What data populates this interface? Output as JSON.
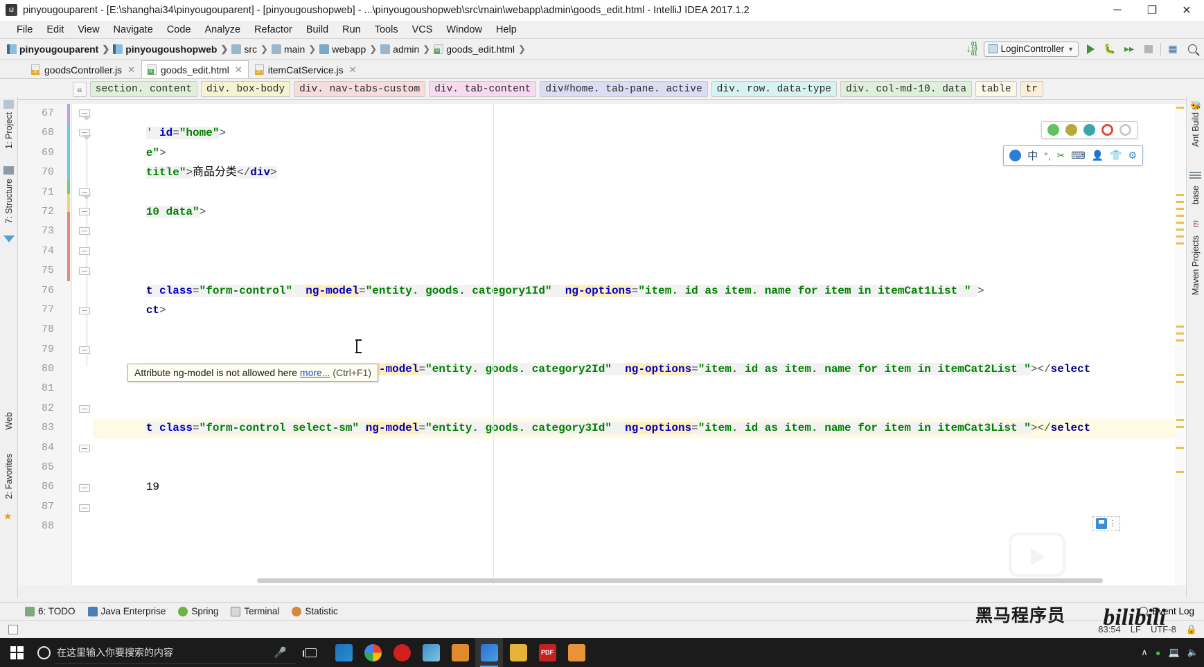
{
  "window": {
    "title": "pinyougouparent - [E:\\shanghai34\\pinyougouparent] - [pinyougoushopweb] - ...\\pinyougoushopweb\\src\\main\\webapp\\admin\\goods_edit.html - IntelliJ IDEA 2017.1.2",
    "minimize": "─",
    "maximize": "❐",
    "close": "✕"
  },
  "menu": [
    "File",
    "Edit",
    "View",
    "Navigate",
    "Code",
    "Analyze",
    "Refactor",
    "Build",
    "Run",
    "Tools",
    "VCS",
    "Window",
    "Help"
  ],
  "navbar": {
    "crumbs": [
      {
        "label": "pinyougouparent",
        "icon": "module-icon",
        "bold": true
      },
      {
        "label": "pinyougoushopweb",
        "icon": "module-icon",
        "bold": true
      },
      {
        "label": "src",
        "icon": "folder-icon",
        "bold": false
      },
      {
        "label": "main",
        "icon": "folder-icon",
        "bold": false
      },
      {
        "label": "webapp",
        "icon": "folder-blue-icon",
        "bold": false
      },
      {
        "label": "admin",
        "icon": "folder-icon",
        "bold": false
      },
      {
        "label": "goods_edit.html",
        "icon": "html-file-icon",
        "bold": false
      }
    ],
    "run_config": "LoginController",
    "icons": [
      "update-project-icon",
      "run-icon",
      "debug-icon",
      "run-coverage-icon",
      "stop-icon",
      "build-icon",
      "search-everywhere-icon"
    ]
  },
  "tabs": [
    {
      "label": "goodsController.js",
      "type": "js",
      "active": false
    },
    {
      "label": "goods_edit.html",
      "type": "html",
      "active": true
    },
    {
      "label": "itemCatService.js",
      "type": "js",
      "active": false
    }
  ],
  "element_breadcrumb": {
    "collapse_label": "«",
    "chips": [
      {
        "label": "section. content",
        "color": "#dff0da"
      },
      {
        "label": "div. box-body",
        "color": "#f5f3d0"
      },
      {
        "label": "div. nav-tabs-custom",
        "color": "#f7dcdc"
      },
      {
        "label": "div. tab-content",
        "color": "#f7daf0"
      },
      {
        "label": "div#home. tab-pane. active",
        "color": "#dcdcf5"
      },
      {
        "label": "div. row. data-type",
        "color": "#d6f2f2"
      },
      {
        "label": "div. col-md-10. data",
        "color": "#dff0da"
      },
      {
        "label": "table",
        "color": "#faf8e8"
      },
      {
        "label": "tr",
        "color": "#faf0da"
      }
    ]
  },
  "left_tool_strip": [
    "1: Project",
    "7: Structure",
    "Web",
    "2: Favorites"
  ],
  "right_tool_strip": [
    "Ant Build",
    "base",
    "m",
    "Maven Projects"
  ],
  "editor": {
    "lines": [
      {
        "num": "67",
        "text": "' id=\"home\">",
        "highlight": false
      },
      {
        "num": "68",
        "text": "e\">",
        "highlight": false
      },
      {
        "num": "69",
        "text": "title\">商品分类</div>",
        "highlight": false
      },
      {
        "num": "70",
        "text": "",
        "highlight": false
      },
      {
        "num": "71",
        "text": "10 data\">",
        "highlight": false
      },
      {
        "num": "72",
        "text": "",
        "highlight": false
      },
      {
        "num": "73",
        "text": "",
        "highlight": false
      },
      {
        "num": "74",
        "text": "",
        "highlight": false
      },
      {
        "num": "75",
        "text": "t class=\"form-control\"  ng-model=\"entity. goods. category1Id\"  ng-options=\"item. id as item. name for item in itemCat1List \" >",
        "highlight": false
      },
      {
        "num": "76",
        "text": "ct>",
        "highlight": false
      },
      {
        "num": "77",
        "text": "",
        "highlight": false
      },
      {
        "num": "78",
        "text": "",
        "highlight": false
      },
      {
        "num": "79",
        "text": "t class=\"form-control select-sm\" ng-model=\"entity. goods. category2Id\"  ng-options=\"item. id as item. name for item in itemCat2List \"></select",
        "highlight": false
      },
      {
        "num": "80",
        "text": "",
        "highlight": false
      },
      {
        "num": "81",
        "text": "",
        "highlight": false
      },
      {
        "num": "82",
        "text": "t class=\"form-control select-sm\" ng-model=\"entity. goods. category3Id\"  ng-options=\"item. id as item. name for item in itemCat3List \"></select",
        "highlight": false
      },
      {
        "num": "83",
        "text": "",
        "highlight": true
      },
      {
        "num": "84",
        "text": "",
        "highlight": false
      },
      {
        "num": "85",
        "text": "19",
        "highlight": false
      },
      {
        "num": "86",
        "text": "",
        "highlight": false
      },
      {
        "num": "87",
        "text": "",
        "highlight": false
      },
      {
        "num": "88",
        "text": "",
        "highlight": false
      }
    ],
    "tooltip": {
      "message": "Attribute ng-model is not allowed here",
      "link": "more...",
      "shortcut": "(Ctrl+F1)"
    }
  },
  "bottom_bar": {
    "items": [
      {
        "label": "6: TODO",
        "icon": "todo-icon",
        "color": "#6f9f6f"
      },
      {
        "label": "Java Enterprise",
        "icon": "java-enterprise-icon",
        "color": "#4a7fb5"
      },
      {
        "label": "Spring",
        "icon": "spring-icon",
        "color": "#6db33f"
      },
      {
        "label": "Terminal",
        "icon": "terminal-icon",
        "color": "#707070"
      },
      {
        "label": "Statistic",
        "icon": "statistic-icon",
        "color": "#d4893a"
      }
    ],
    "event_log": "Event Log"
  },
  "status_bar": {
    "encoding": "UTF-8",
    "line_sep": "LF",
    "caret_pos": "83:54"
  },
  "watermarks": {
    "chinese": "黑马程序员",
    "bilibili": "bilibili"
  },
  "taskbar": {
    "search_placeholder": "在这里输入你要搜索的内容",
    "apps": [
      {
        "name": "app-ps-icon",
        "color": "#2a6fb0",
        "active": false
      },
      {
        "name": "app-chrome-icon",
        "color": "#3aa757",
        "active": false
      },
      {
        "name": "app-opera-icon",
        "color": "#cf2020",
        "active": false
      },
      {
        "name": "app-editor-icon",
        "color": "#3b8fc9",
        "active": false
      },
      {
        "name": "app-window-icon",
        "color": "#e08a2a",
        "active": false
      },
      {
        "name": "app-intellij-icon",
        "color": "#4a8fd4",
        "active": true
      },
      {
        "name": "app-explorer-icon",
        "color": "#e6b33a",
        "active": false
      },
      {
        "name": "app-pdf-icon",
        "color": "#c42121",
        "active": false
      },
      {
        "name": "app-sublime-icon",
        "color": "#e8923a",
        "active": false
      }
    ],
    "tray": {
      "chevron": "∧",
      "clock": ""
    }
  },
  "colors": {
    "accent": "#3a8fd4",
    "tag": "#000080",
    "attr": "#0000c0",
    "value": "#008000",
    "highlight_bg": "#fffae4",
    "attr_highlight": "#fdeec0"
  }
}
